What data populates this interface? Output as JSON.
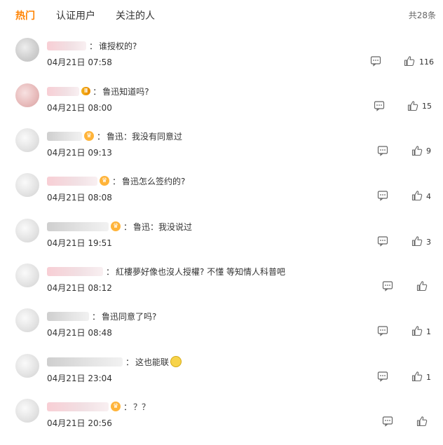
{
  "tabs": [
    {
      "label": "热门"
    },
    {
      "label": "认证用户"
    },
    {
      "label": "关注的人"
    }
  ],
  "total": "共28条",
  "colors": {
    "accent": "#ff8200"
  },
  "comments": [
    {
      "text": "谁授权的?",
      "time": "04月21日 07:58",
      "likes": "116"
    },
    {
      "text": "鲁迅知道吗?",
      "time": "04月21日 08:00",
      "likes": "15"
    },
    {
      "text": "鲁迅：我没有同意过",
      "time": "04月21日 09:13",
      "likes": "9"
    },
    {
      "text": "鲁迅怎么签约的?",
      "time": "04月21日 08:08",
      "likes": "4"
    },
    {
      "text": "鲁迅：我没说过",
      "time": "04月21日 19:51",
      "likes": "3"
    },
    {
      "text": "紅樓夢好像也沒人授權? 不懂 等知情人科普吧",
      "time": "04月21日 08:12",
      "likes": ""
    },
    {
      "text": "鲁迅同意了吗?",
      "time": "04月21日 08:48",
      "likes": "1"
    },
    {
      "text": "这也能联",
      "time": "04月21日 23:04",
      "likes": "1"
    },
    {
      "text": "？？",
      "time": "04月21日 20:56",
      "likes": ""
    }
  ]
}
